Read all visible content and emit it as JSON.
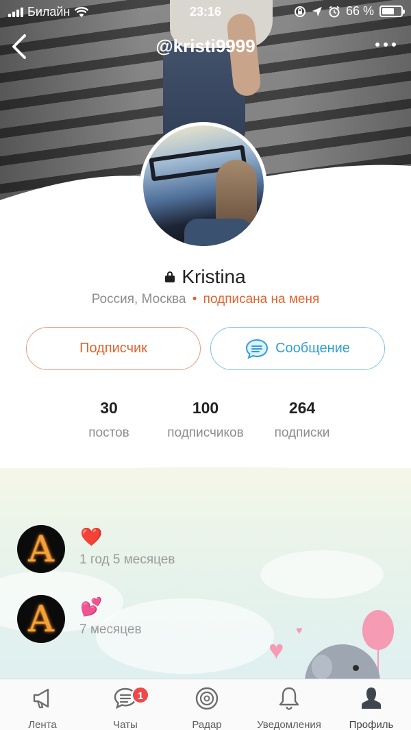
{
  "status_bar": {
    "carrier": "Билайн",
    "time": "23:16",
    "battery_percent": "66 %",
    "battery_level": 0.66
  },
  "nav": {
    "title": "@kristi9999",
    "back_icon": "chevron-left-icon",
    "more_icon": "more-dots-icon"
  },
  "profile": {
    "name": "Kristina",
    "private_icon": "lock-icon",
    "location": "Россия, Москва",
    "separator": "•",
    "follow_status": "подписана на меня",
    "accent_color": "#e3622d",
    "message_color": "#2e9fd8"
  },
  "actions": {
    "follow_label": "Подписчик",
    "message_label": "Сообщение"
  },
  "stats": [
    {
      "value": "30",
      "label": "постов"
    },
    {
      "value": "100",
      "label": "подписчиков"
    },
    {
      "value": "264",
      "label": "подписки"
    }
  ],
  "feed": [
    {
      "emoji": "❤️",
      "time": "1 год 5 месяцев"
    },
    {
      "emoji": "💕",
      "time": "7 месяцев"
    }
  ],
  "tabbar": {
    "items": [
      {
        "label": "Лента",
        "icon": "megaphone-icon"
      },
      {
        "label": "Чаты",
        "icon": "chat-icon",
        "badge": "1"
      },
      {
        "label": "Радар",
        "icon": "radar-icon"
      },
      {
        "label": "Уведомления",
        "icon": "bell-icon"
      },
      {
        "label": "Профиль",
        "icon": "profile-icon",
        "active": true
      }
    ]
  }
}
